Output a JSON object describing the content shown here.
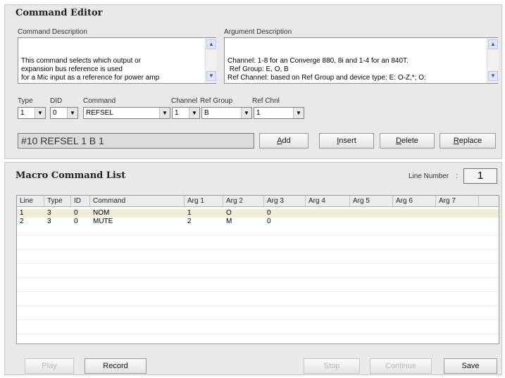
{
  "editor": {
    "title": "Command Editor",
    "command_description_label": "Command Description",
    "command_description_text": "This command selects which output or\nexpansion bus reference is used\nfor a Mic input as a reference for power amp",
    "argument_description_label": "Argument Description",
    "argument_description_text": "Channel: 1-8 for an Converge 880, 8i and 1-4 for an 840T.\n Ref Group: E, O, B\nRef Channel: based on Ref Group and device type: E: O-Z,*; O:",
    "fields": {
      "type": {
        "label": "Type",
        "value": "1"
      },
      "did": {
        "label": "DID",
        "value": "0"
      },
      "command": {
        "label": "Command",
        "value": "REFSEL"
      },
      "channel": {
        "label": "Channel",
        "value": "1"
      },
      "ref_group": {
        "label": "Ref Group",
        "value": "B"
      },
      "ref_chnl": {
        "label": "Ref Chnl",
        "value": "1"
      }
    },
    "command_line": "#10 REFSEL 1 B 1",
    "buttons": {
      "add": {
        "hot": "A",
        "rest": "dd"
      },
      "insert": {
        "hot": "I",
        "rest": "nsert"
      },
      "delete": {
        "hot": "D",
        "rest": "elete"
      },
      "replace": {
        "hot": "R",
        "rest": "eplace"
      }
    }
  },
  "macro": {
    "title": "Macro Command List",
    "line_number_label": "Line Number",
    "line_number_value": "1",
    "columns": [
      "Line",
      "Type",
      "ID",
      "Command",
      "Arg 1",
      "Arg 2",
      "Arg 3",
      "Arg 4",
      "Arg 5",
      "Arg 6",
      "Arg 7"
    ],
    "rows": [
      {
        "line": "1",
        "type": "3",
        "id": "0",
        "command": "NOM",
        "arg1": "1",
        "arg2": "O",
        "arg3": "0",
        "arg4": "",
        "arg5": "",
        "arg6": "",
        "arg7": ""
      },
      {
        "line": "2",
        "type": "3",
        "id": "0",
        "command": "MUTE",
        "arg1": "2",
        "arg2": "M",
        "arg3": "0",
        "arg4": "",
        "arg5": "",
        "arg6": "",
        "arg7": ""
      }
    ],
    "selected_row": 0,
    "buttons": {
      "play": "Play",
      "record": "Record",
      "stop": "Stop",
      "continue": "Continue",
      "save": "Save"
    }
  }
}
